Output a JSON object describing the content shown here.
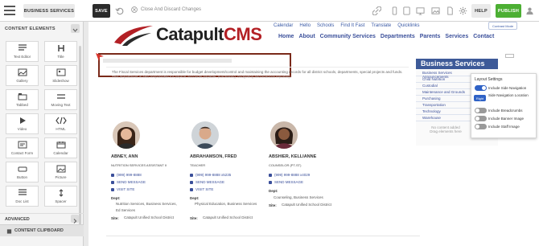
{
  "toolbar": {
    "page_selector": "BUSINESS SERVICES",
    "save": "SAVE",
    "close_discard": "Close And Discard Changes",
    "help": "HELP",
    "publish": "PUBLISH",
    "publish_color": "#4caf33"
  },
  "left_panel": {
    "heading": "CONTENT ELEMENTS",
    "tiles": [
      {
        "label": "Text Editor",
        "icon": "text-editor-icon"
      },
      {
        "label": "Title",
        "icon": "title-icon"
      },
      {
        "label": "Gallery",
        "icon": "gallery-icon"
      },
      {
        "label": "Slideshow",
        "icon": "slideshow-icon"
      },
      {
        "label": "Tabbed",
        "icon": "tabbed-icon"
      },
      {
        "label": "Moving Text",
        "icon": "moving-text-icon"
      },
      {
        "label": "Video",
        "icon": "video-icon"
      },
      {
        "label": "HTML",
        "icon": "html-icon"
      },
      {
        "label": "Contact Form",
        "icon": "contact-form-icon"
      },
      {
        "label": "Calendar",
        "icon": "calendar-icon"
      },
      {
        "label": "Button",
        "icon": "button-icon"
      },
      {
        "label": "Picture",
        "icon": "picture-icon"
      },
      {
        "label": "Doc List",
        "icon": "doc-list-icon"
      },
      {
        "label": "Spacer",
        "icon": "spacer-icon"
      }
    ],
    "advanced": "ADVANCED",
    "clipboard": "CONTENT CLIPBOARD"
  },
  "site": {
    "logo_main": "Catapult",
    "logo_accent": "CMS",
    "logo_accent_color": "#b32025",
    "util_nav": [
      "Calendar",
      "Hello",
      "Schools",
      "Find It Fast",
      "Translate",
      "Quicklinks"
    ],
    "contrast_mode": "Contrast Mode",
    "main_nav": [
      "Home",
      "About",
      "Community Services",
      "Departments",
      "Parents",
      "Services",
      "Contact"
    ],
    "body_text": "The Fiscal Services department is responsible for budget development/control and maintaining the accounting records for all district schools, departments, special projects and funds.",
    "body_text_2": "This department is also responsible for payroll, accounts payable, purchasing, budgeting and financial reporting."
  },
  "sidebar": {
    "title": "Business Services",
    "items": [
      "Business Services Announcements",
      "Child Nutrition",
      "Custodial",
      "Maintenance and Grounds",
      "Purchasing",
      "Transportation",
      "Technology",
      "Warehouse"
    ],
    "drop_hint_1": "No content added",
    "drop_hint_2": "Drag elements here"
  },
  "layout_settings": {
    "title": "Layout Settings",
    "options": [
      {
        "label": "Include Side Navigation",
        "on": true
      },
      {
        "label": "Side Navigation Location",
        "on": null,
        "chip": "Right"
      },
      {
        "label": "Include Breadcrumbs",
        "on": false
      },
      {
        "label": "Include Banner Image",
        "on": false
      },
      {
        "label": "Include Staff Image",
        "on": false
      }
    ]
  },
  "staff": [
    {
      "name": "ABNEY, ANN",
      "title": "NUTRITION SERVICES ASSISTANT II",
      "phone": "(999) 999-8888",
      "message": "SEND MESSAGE",
      "site_link": "VISIT SITE",
      "dept_label": "Dept:",
      "dept": "Nutrition Services, Business Services, Ed Services",
      "site_label": "Site:",
      "site": "Catapult Unified School District"
    },
    {
      "name": "ABRAHAMSON, FRED",
      "title": "TEACHER",
      "phone": "(999) 999-8888 x5235",
      "message": "SEND MESSAGE",
      "site_link": "VISIT SITE",
      "dept_label": "Dept:",
      "dept": "Physical Education, Business Services",
      "site_label": "Site:",
      "site": "Catapult Unified School District"
    },
    {
      "name": "ABSHIER, KELLIANNE",
      "title": "COUNSELOR (PT-ST)",
      "phone": "(999) 999-8888 x4029",
      "message": "SEND MESSAGE",
      "site_link": "",
      "dept_label": "Dept:",
      "dept": "Counseling, Business Services",
      "site_label": "Site:",
      "site": "Catapult Unified School District"
    }
  ]
}
